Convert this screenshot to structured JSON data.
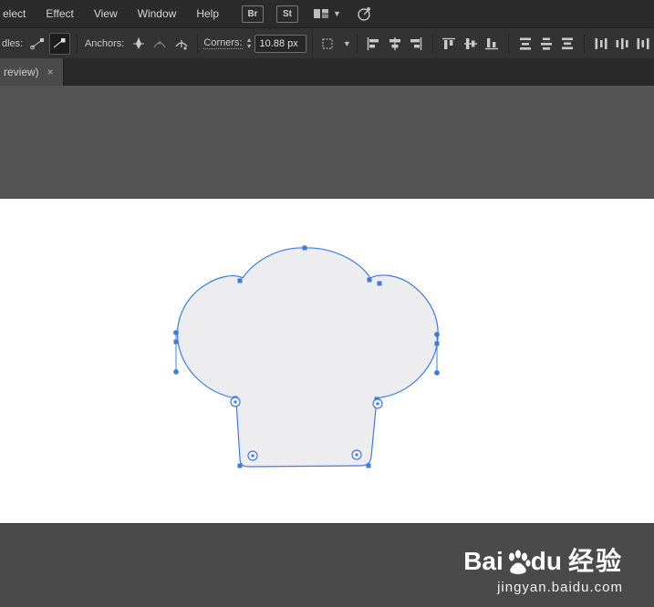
{
  "menubar": {
    "items": [
      "elect",
      "Effect",
      "View",
      "Window",
      "Help"
    ],
    "badges": [
      "Br",
      "St"
    ]
  },
  "controlbar": {
    "handles_label": "dles:",
    "anchors_label": "Anchors:",
    "corners_label": "Corners:",
    "corners_value": "10.88 px"
  },
  "tabbar": {
    "tab_label": "review)",
    "close_label": "×"
  },
  "watermark": {
    "bai": "Bai",
    "du": "du",
    "suffix": "经验",
    "url": "jingyan.baidu.com"
  },
  "icons": {
    "appbar": [
      "bridge-badge",
      "stock-badge",
      "arrange-documents-icon",
      "workspace-switcher-icon"
    ],
    "handles": [
      "handle-style-plain-icon",
      "handle-style-solid-icon"
    ],
    "anchors": [
      "convert-anchor-icon",
      "smooth-anchor-icon",
      "cut-path-icon"
    ],
    "align": [
      "align-left-icon",
      "align-h-center-icon",
      "align-right-icon",
      "align-top-icon",
      "align-v-center-icon",
      "align-bottom-icon",
      "distribute-top-icon",
      "distribute-v-center-icon",
      "distribute-bottom-icon",
      "distribute-h-left-icon",
      "distribute-h-center-icon",
      "distribute-h-right-icon"
    ]
  },
  "colors": {
    "accent_blue": "#3c7be4",
    "menubar_bg": "#2b2b2b",
    "controlbar_bg": "#333333",
    "canvas_bg": "#545454",
    "artboard_bg": "#ffffff",
    "bottom_bg": "#4a4a4a",
    "shape_fill": "#ededf0"
  }
}
